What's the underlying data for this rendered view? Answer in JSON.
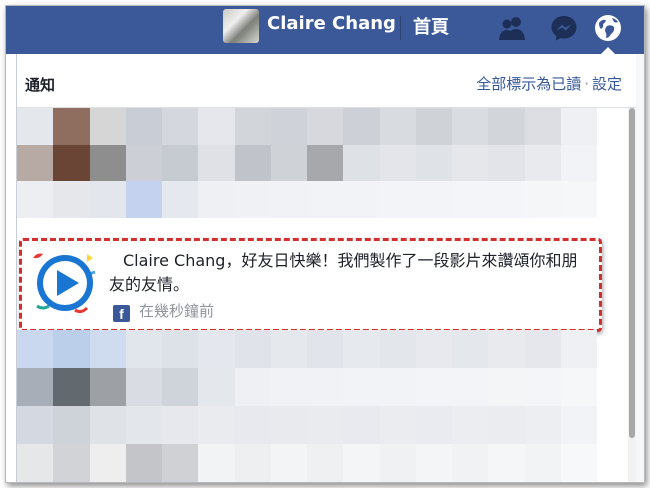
{
  "topbar": {
    "username": "Claire Chang",
    "home_label": "首頁",
    "icons": [
      "friends-icon",
      "messenger-icon",
      "globe-icon"
    ],
    "bg_color": "#3b5998"
  },
  "notifications_panel": {
    "title": "通知",
    "mark_all_read": "全部標示為已讀",
    "separator": "·",
    "settings": "設定"
  },
  "highlighted_notification": {
    "text": "Claire Chang，好友日快樂！我們製作了一段影片來讚頌你和朋友的友情。",
    "source_icon": "facebook-icon",
    "time": "在幾秒鐘前",
    "highlight_color": "#d32f2f"
  },
  "colors": {
    "link": "#365899",
    "meta": "#90949c"
  }
}
